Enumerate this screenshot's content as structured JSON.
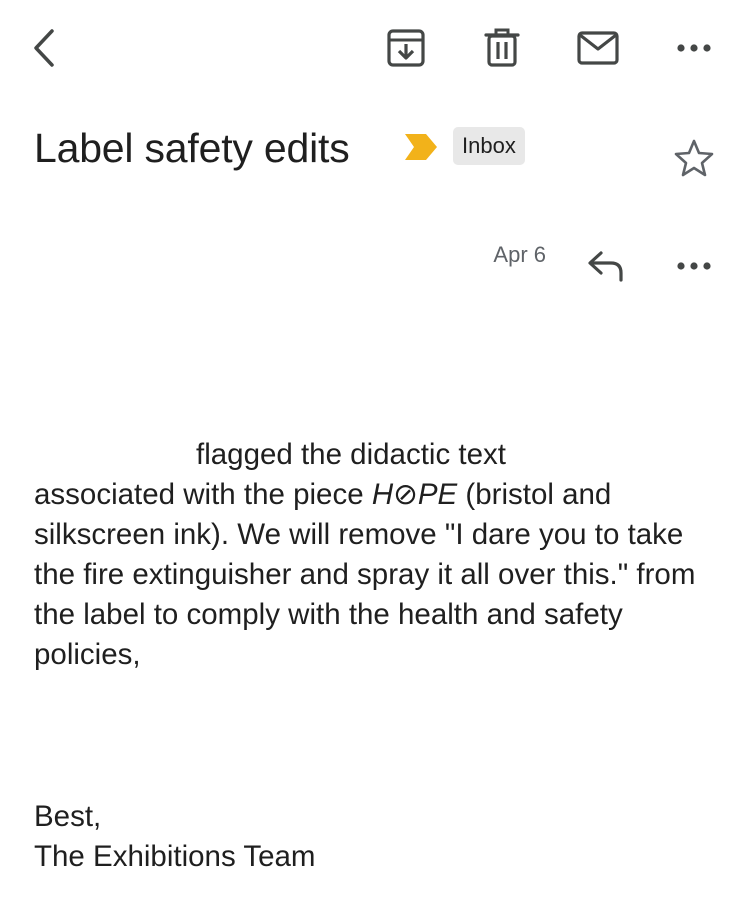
{
  "toolbar": {
    "back_icon": "chevron-left-icon",
    "archive_icon": "archive-icon",
    "delete_icon": "trash-icon",
    "mark_unread_icon": "mail-icon",
    "more_icon": "more-horizontal-icon"
  },
  "email": {
    "subject": "Label safety edits",
    "importance_color": "#F2B21A",
    "label": "Inbox",
    "starred": false,
    "date": "Apr 6",
    "body": {
      "line1": "flagged the didactic text",
      "part2_before_title": "associated with the piece ",
      "piece_title": "H⊘PE",
      "part2_after_title": " (bristol and silkscreen ink). We will remove \"I dare you to take the fire extinguisher and spray it all over this.\" from the label to comply with the health and safety policies,"
    },
    "signoff": "Best,",
    "signature": "The Exhibitions Team"
  },
  "colors": {
    "icon_gray": "#5f6368",
    "chip_bg": "#e8e8e8",
    "text": "#1f1f1f"
  }
}
